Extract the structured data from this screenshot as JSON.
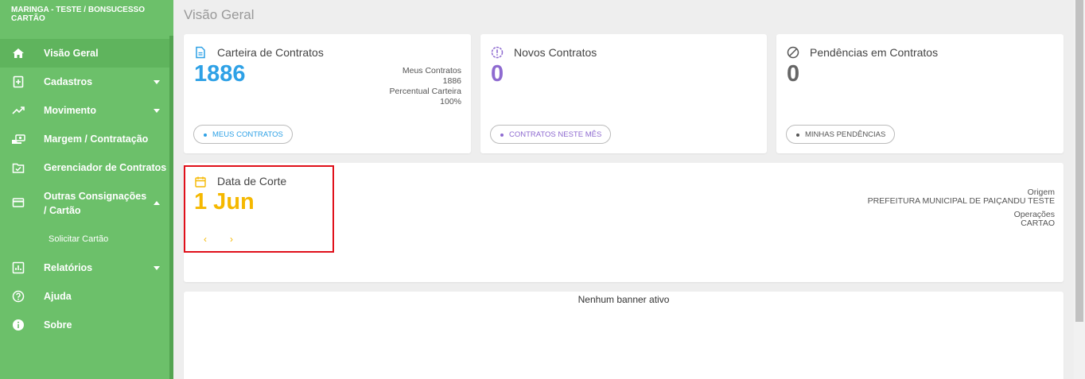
{
  "sidebar": {
    "brand": "MARINGA - TESTE / BONSUCESSO CARTÃO",
    "items": [
      {
        "label": "Visão Geral",
        "icon": "home-icon"
      },
      {
        "label": "Cadastros",
        "icon": "add-document-icon"
      },
      {
        "label": "Movimento",
        "icon": "trending-up-icon"
      },
      {
        "label": "Margem / Contratação",
        "icon": "money-hand-icon"
      },
      {
        "label": "Gerenciador de Contratos",
        "icon": "checked-folder-icon"
      },
      {
        "label": "Outras Consignações / Cartão",
        "icon": "credit-card-icon"
      },
      {
        "label": "Relatórios",
        "icon": "bar-chart-icon"
      },
      {
        "label": "Ajuda",
        "icon": "help-circle-icon"
      },
      {
        "label": "Sobre",
        "icon": "info-circle-icon"
      }
    ],
    "sub_items": [
      "Solicitar Cartão"
    ]
  },
  "main": {
    "title": "Visão Geral",
    "cards": [
      {
        "title": "Carteira de Contratos",
        "value": "1886",
        "color": "#2ea1e6",
        "info": [
          "Meus Contratos",
          "1886",
          "Percentual Carteira",
          "100%"
        ],
        "button": "MEUS CONTRATOS"
      },
      {
        "title": "Novos Contratos",
        "value": "0",
        "color": "#8e6ad0",
        "button": "CONTRATOS NESTE MÊS"
      },
      {
        "title": "Pendências em Contratos",
        "value": "0",
        "color": "#666666",
        "button": "MINHAS PENDÊNCIAS"
      }
    ],
    "cutoff": {
      "title": "Data de Corte",
      "value": "1 Jun",
      "color": "#f5b800",
      "prev": "‹",
      "next": "›",
      "origin_label": "Origem",
      "origin_value": "PREFEITURA MUNICIPAL DE PAIÇANDU TESTE",
      "operations_label": "Operações",
      "operations_value": "CARTAO"
    },
    "banner": "Nenhum banner ativo"
  }
}
